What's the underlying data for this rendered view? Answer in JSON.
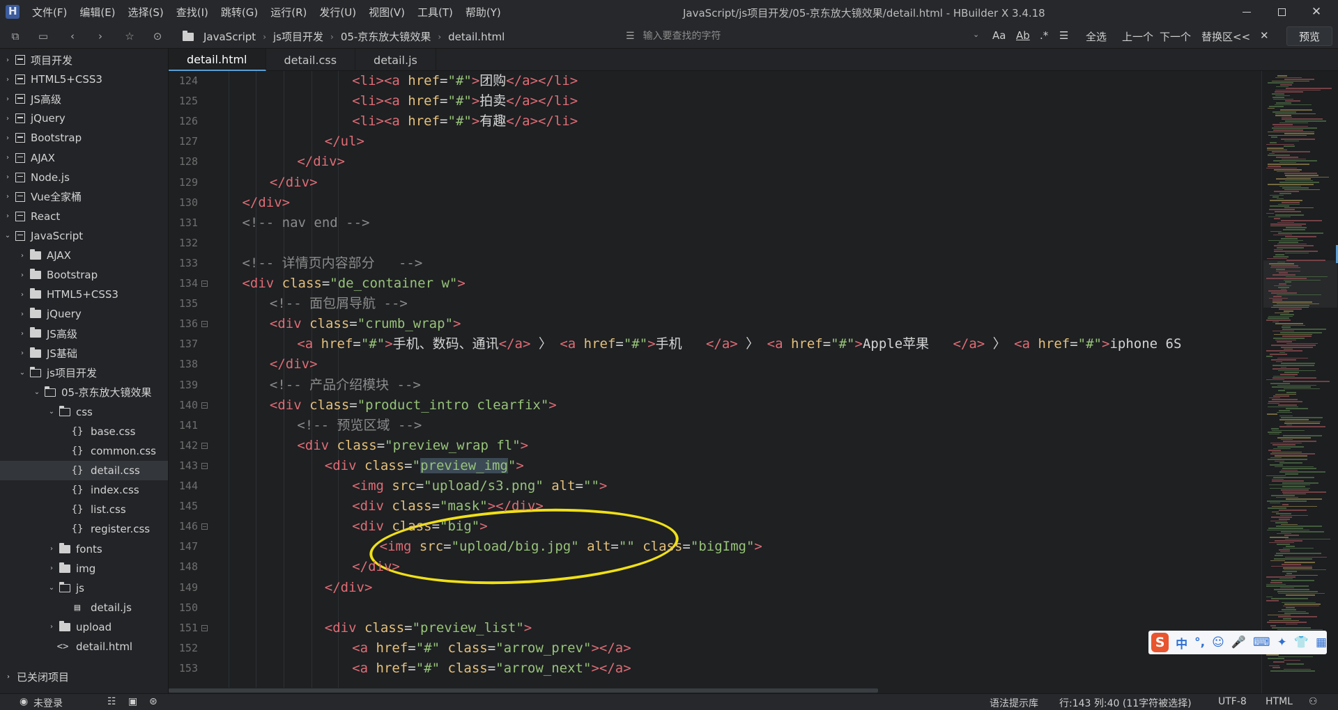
{
  "menubar": {
    "items": [
      "文件(F)",
      "编辑(E)",
      "选择(S)",
      "查找(I)",
      "跳转(G)",
      "运行(R)",
      "发行(U)",
      "视图(V)",
      "工具(T)",
      "帮助(Y)"
    ],
    "window_title": "JavaScript/js项目开发/05-京东放大镜效果/detail.html - HBuilder X 3.4.18"
  },
  "toolbar": {
    "breadcrumb": [
      "JavaScript",
      "js项目开发",
      "05-京东放大镜效果",
      "detail.html"
    ],
    "search_placeholder": "输入要查找的字符",
    "search_options": {
      "case": "Aa",
      "word": "Ab",
      "regex": ".*",
      "select_all": "全选",
      "prev": "上一个",
      "next": "下一个",
      "replace_toggle": "替换区<<",
      "close": "✕"
    },
    "preview_label": "预览"
  },
  "sidebar": {
    "items": [
      {
        "label": "项目开发",
        "kind": "project",
        "depth": 0,
        "arrow": "right"
      },
      {
        "label": "HTML5+CSS3",
        "kind": "project",
        "depth": 0,
        "arrow": "right"
      },
      {
        "label": "JS高级",
        "kind": "project",
        "depth": 0,
        "arrow": "right"
      },
      {
        "label": "jQuery",
        "kind": "project",
        "depth": 0,
        "arrow": "right"
      },
      {
        "label": "Bootstrap",
        "kind": "project",
        "depth": 0,
        "arrow": "right"
      },
      {
        "label": "AJAX",
        "kind": "project",
        "depth": 0,
        "arrow": "right"
      },
      {
        "label": "Node.js",
        "kind": "project",
        "depth": 0,
        "arrow": "right"
      },
      {
        "label": "Vue全家桶",
        "kind": "project",
        "depth": 0,
        "arrow": "right"
      },
      {
        "label": "React",
        "kind": "project",
        "depth": 0,
        "arrow": "right"
      },
      {
        "label": "JavaScript",
        "kind": "project",
        "depth": 0,
        "arrow": "down"
      },
      {
        "label": "AJAX",
        "kind": "folder",
        "depth": 1,
        "arrow": "right"
      },
      {
        "label": "Bootstrap",
        "kind": "folder",
        "depth": 1,
        "arrow": "right"
      },
      {
        "label": "HTML5+CSS3",
        "kind": "folder",
        "depth": 1,
        "arrow": "right"
      },
      {
        "label": "jQuery",
        "kind": "folder",
        "depth": 1,
        "arrow": "right"
      },
      {
        "label": "JS高级",
        "kind": "folder",
        "depth": 1,
        "arrow": "right"
      },
      {
        "label": "JS基础",
        "kind": "folder",
        "depth": 1,
        "arrow": "right"
      },
      {
        "label": "js项目开发",
        "kind": "folder-open",
        "depth": 1,
        "arrow": "down"
      },
      {
        "label": "05-京东放大镜效果",
        "kind": "folder-open",
        "depth": 2,
        "arrow": "down"
      },
      {
        "label": "css",
        "kind": "folder-open",
        "depth": 3,
        "arrow": "down"
      },
      {
        "label": "base.css",
        "kind": "css",
        "depth": 4,
        "arrow": ""
      },
      {
        "label": "common.css",
        "kind": "css",
        "depth": 4,
        "arrow": ""
      },
      {
        "label": "detail.css",
        "kind": "css",
        "depth": 4,
        "arrow": "",
        "selected": true
      },
      {
        "label": "index.css",
        "kind": "css",
        "depth": 4,
        "arrow": ""
      },
      {
        "label": "list.css",
        "kind": "css",
        "depth": 4,
        "arrow": ""
      },
      {
        "label": "register.css",
        "kind": "css",
        "depth": 4,
        "arrow": ""
      },
      {
        "label": "fonts",
        "kind": "folder",
        "depth": 3,
        "arrow": "right"
      },
      {
        "label": "img",
        "kind": "folder",
        "depth": 3,
        "arrow": "right"
      },
      {
        "label": "js",
        "kind": "folder-open",
        "depth": 3,
        "arrow": "down"
      },
      {
        "label": "detail.js",
        "kind": "js",
        "depth": 4,
        "arrow": ""
      },
      {
        "label": "upload",
        "kind": "folder",
        "depth": 3,
        "arrow": "right"
      },
      {
        "label": "detail.html",
        "kind": "html",
        "depth": 3,
        "arrow": ""
      }
    ],
    "closed_projects_label": "已关闭项目"
  },
  "tabs": [
    {
      "label": "detail.html",
      "active": true
    },
    {
      "label": "detail.css",
      "active": false
    },
    {
      "label": "detail.js",
      "active": false
    }
  ],
  "editor": {
    "lines": [
      {
        "n": 124,
        "indent": 10,
        "tokens": [
          [
            "tag",
            "<li>"
          ],
          [
            "tag",
            "<a "
          ],
          [
            "attr",
            "href"
          ],
          [
            "punct",
            "="
          ],
          [
            "str",
            "\"#\""
          ],
          [
            "tag",
            ">"
          ],
          [
            "txt",
            "团购"
          ],
          [
            "tag",
            "</a></li>"
          ]
        ]
      },
      {
        "n": 125,
        "indent": 10,
        "tokens": [
          [
            "tag",
            "<li>"
          ],
          [
            "tag",
            "<a "
          ],
          [
            "attr",
            "href"
          ],
          [
            "punct",
            "="
          ],
          [
            "str",
            "\"#\""
          ],
          [
            "tag",
            ">"
          ],
          [
            "txt",
            "拍卖"
          ],
          [
            "tag",
            "</a></li>"
          ]
        ]
      },
      {
        "n": 126,
        "indent": 10,
        "tokens": [
          [
            "tag",
            "<li>"
          ],
          [
            "tag",
            "<a "
          ],
          [
            "attr",
            "href"
          ],
          [
            "punct",
            "="
          ],
          [
            "str",
            "\"#\""
          ],
          [
            "tag",
            ">"
          ],
          [
            "txt",
            "有趣"
          ],
          [
            "tag",
            "</a></li>"
          ]
        ]
      },
      {
        "n": 127,
        "indent": 8,
        "tokens": [
          [
            "tag",
            "</ul>"
          ]
        ]
      },
      {
        "n": 128,
        "indent": 6,
        "tokens": [
          [
            "tag",
            "</div>"
          ]
        ]
      },
      {
        "n": 129,
        "indent": 4,
        "tokens": [
          [
            "tag",
            "</div>"
          ]
        ]
      },
      {
        "n": 130,
        "indent": 2,
        "tokens": [
          [
            "tag",
            "</div>"
          ]
        ]
      },
      {
        "n": 131,
        "indent": 2,
        "tokens": [
          [
            "cmt",
            "<!-- nav end -->"
          ]
        ]
      },
      {
        "n": 132,
        "indent": 0,
        "tokens": []
      },
      {
        "n": 133,
        "indent": 2,
        "tokens": [
          [
            "cmt",
            "<!-- 详情页内容部分   -->"
          ]
        ]
      },
      {
        "n": 134,
        "indent": 2,
        "fold": true,
        "tokens": [
          [
            "tag",
            "<div "
          ],
          [
            "attr",
            "class"
          ],
          [
            "punct",
            "="
          ],
          [
            "str",
            "\"de_container w\""
          ],
          [
            "tag",
            ">"
          ]
        ]
      },
      {
        "n": 135,
        "indent": 4,
        "tokens": [
          [
            "cmt",
            "<!-- 面包屑导航 -->"
          ]
        ]
      },
      {
        "n": 136,
        "indent": 4,
        "fold": true,
        "tokens": [
          [
            "tag",
            "<div "
          ],
          [
            "attr",
            "class"
          ],
          [
            "punct",
            "="
          ],
          [
            "str",
            "\"crumb_wrap\""
          ],
          [
            "tag",
            ">"
          ]
        ]
      },
      {
        "n": 137,
        "indent": 6,
        "tokens": [
          [
            "tag",
            "<a "
          ],
          [
            "attr",
            "href"
          ],
          [
            "punct",
            "="
          ],
          [
            "str",
            "\"#\""
          ],
          [
            "tag",
            ">"
          ],
          [
            "txt",
            "手机、数码、通讯"
          ],
          [
            "tag",
            "</a>"
          ],
          [
            "txt",
            " 〉 "
          ],
          [
            "tag",
            "<a "
          ],
          [
            "attr",
            "href"
          ],
          [
            "punct",
            "="
          ],
          [
            "str",
            "\"#\""
          ],
          [
            "tag",
            ">"
          ],
          [
            "txt",
            "手机   "
          ],
          [
            "tag",
            "</a>"
          ],
          [
            "txt",
            " 〉 "
          ],
          [
            "tag",
            "<a "
          ],
          [
            "attr",
            "href"
          ],
          [
            "punct",
            "="
          ],
          [
            "str",
            "\"#\""
          ],
          [
            "tag",
            ">"
          ],
          [
            "txt",
            "Apple苹果   "
          ],
          [
            "tag",
            "</a>"
          ],
          [
            "txt",
            " 〉 "
          ],
          [
            "tag",
            "<a "
          ],
          [
            "attr",
            "href"
          ],
          [
            "punct",
            "="
          ],
          [
            "str",
            "\"#\""
          ],
          [
            "tag",
            ">"
          ],
          [
            "txt",
            "iphone 6S"
          ]
        ]
      },
      {
        "n": 138,
        "indent": 4,
        "tokens": [
          [
            "tag",
            "</div>"
          ]
        ]
      },
      {
        "n": 139,
        "indent": 4,
        "tokens": [
          [
            "cmt",
            "<!-- 产品介绍模块 -->"
          ]
        ]
      },
      {
        "n": 140,
        "indent": 4,
        "fold": true,
        "tokens": [
          [
            "tag",
            "<div "
          ],
          [
            "attr",
            "class"
          ],
          [
            "punct",
            "="
          ],
          [
            "str",
            "\"product_intro clearfix\""
          ],
          [
            "tag",
            ">"
          ]
        ]
      },
      {
        "n": 141,
        "indent": 6,
        "tokens": [
          [
            "cmt",
            "<!-- 预览区域 -->"
          ]
        ]
      },
      {
        "n": 142,
        "indent": 6,
        "fold": true,
        "tokens": [
          [
            "tag",
            "<div "
          ],
          [
            "attr",
            "class"
          ],
          [
            "punct",
            "="
          ],
          [
            "str",
            "\"preview_wrap fl\""
          ],
          [
            "tag",
            ">"
          ]
        ]
      },
      {
        "n": 143,
        "indent": 8,
        "fold": true,
        "tokens": [
          [
            "tag",
            "<div "
          ],
          [
            "attr",
            "class"
          ],
          [
            "punct",
            "="
          ],
          [
            "str",
            "\""
          ],
          [
            "hl",
            "preview_img"
          ],
          [
            "str",
            "\""
          ],
          [
            "tag",
            ">"
          ]
        ]
      },
      {
        "n": 144,
        "indent": 10,
        "tokens": [
          [
            "tag",
            "<img "
          ],
          [
            "attr",
            "src"
          ],
          [
            "punct",
            "="
          ],
          [
            "str",
            "\"upload/s3.png\""
          ],
          [
            "txt",
            " "
          ],
          [
            "attr",
            "alt"
          ],
          [
            "punct",
            "="
          ],
          [
            "str",
            "\"\""
          ],
          [
            "tag",
            ">"
          ]
        ]
      },
      {
        "n": 145,
        "indent": 10,
        "tokens": [
          [
            "tag",
            "<div "
          ],
          [
            "attr",
            "class"
          ],
          [
            "punct",
            "="
          ],
          [
            "str",
            "\"mask\""
          ],
          [
            "tag",
            "></div>"
          ]
        ]
      },
      {
        "n": 146,
        "indent": 10,
        "fold": true,
        "tokens": [
          [
            "tag",
            "<div "
          ],
          [
            "attr",
            "class"
          ],
          [
            "punct",
            "="
          ],
          [
            "str",
            "\"big\""
          ],
          [
            "tag",
            ">"
          ]
        ]
      },
      {
        "n": 147,
        "indent": 12,
        "tokens": [
          [
            "tag",
            "<img "
          ],
          [
            "attr",
            "src"
          ],
          [
            "punct",
            "="
          ],
          [
            "str",
            "\"upload/big.jpg\""
          ],
          [
            "txt",
            " "
          ],
          [
            "attr",
            "alt"
          ],
          [
            "punct",
            "="
          ],
          [
            "str",
            "\"\""
          ],
          [
            "txt",
            " "
          ],
          [
            "attr",
            "class"
          ],
          [
            "punct",
            "="
          ],
          [
            "str",
            "\"bigImg\""
          ],
          [
            "tag",
            ">"
          ]
        ]
      },
      {
        "n": 148,
        "indent": 10,
        "tokens": [
          [
            "tag",
            "</div>"
          ]
        ]
      },
      {
        "n": 149,
        "indent": 8,
        "tokens": [
          [
            "tag",
            "</div>"
          ]
        ]
      },
      {
        "n": 150,
        "indent": 0,
        "tokens": []
      },
      {
        "n": 151,
        "indent": 8,
        "fold": true,
        "tokens": [
          [
            "tag",
            "<div "
          ],
          [
            "attr",
            "class"
          ],
          [
            "punct",
            "="
          ],
          [
            "str",
            "\"preview_list\""
          ],
          [
            "tag",
            ">"
          ]
        ]
      },
      {
        "n": 152,
        "indent": 10,
        "tokens": [
          [
            "tag",
            "<a "
          ],
          [
            "attr",
            "href"
          ],
          [
            "punct",
            "="
          ],
          [
            "str",
            "\"#\""
          ],
          [
            "txt",
            " "
          ],
          [
            "attr",
            "class"
          ],
          [
            "punct",
            "="
          ],
          [
            "str",
            "\"arrow_prev\""
          ],
          [
            "tag",
            "></a>"
          ]
        ]
      },
      {
        "n": 153,
        "indent": 10,
        "tokens": [
          [
            "tag",
            "<a "
          ],
          [
            "attr",
            "href"
          ],
          [
            "punct",
            "="
          ],
          [
            "str",
            "\"#\""
          ],
          [
            "txt",
            " "
          ],
          [
            "attr",
            "class"
          ],
          [
            "punct",
            "="
          ],
          [
            "str",
            "\"arrow_next\""
          ],
          [
            "tag",
            "></a>"
          ]
        ]
      }
    ]
  },
  "ime": {
    "logo": "S",
    "items": [
      "中",
      "°,",
      "☺",
      "🎤",
      "⌨",
      "✦",
      "👕",
      "▦"
    ]
  },
  "statusbar": {
    "login": "未登录",
    "syntax_hint": "语法提示库",
    "position": "行:143  列:40 (11字符被选择)",
    "encoding": "UTF-8",
    "language": "HTML"
  },
  "colors": {
    "accent": "#5a9fd6",
    "annotation": "#f0e016",
    "tag": "#e06c75",
    "attr": "#e5c07b",
    "string": "#98c379"
  }
}
